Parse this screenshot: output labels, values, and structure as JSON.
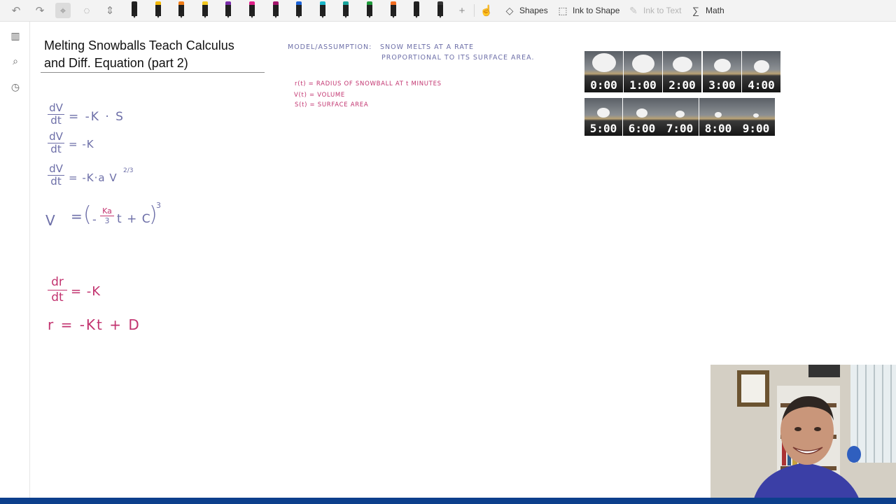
{
  "toolbar": {
    "shapes_label": "Shapes",
    "ink_to_shape_label": "Ink to Shape",
    "ink_to_text_label": "Ink to Text",
    "math_label": "Math",
    "pen_colors": [
      "#222222",
      "#f2b705",
      "#f07d18",
      "#f2c81f",
      "#7a2ca8",
      "#e0218a",
      "#a3146b",
      "#1b62d6",
      "#1ab6c9",
      "#17a39a",
      "#1e9a3a",
      "#f26d21",
      "#222222",
      "#333333"
    ]
  },
  "page": {
    "title_line1": "Melting Snowballs Teach Calculus",
    "title_line2": "and Diff. Equation (part 2)"
  },
  "notes": {
    "model_label": "MODEL/ASSUMPTION:",
    "model_line1": "SNOW MELTS AT A RATE",
    "model_line2": "PROPORTIONAL TO ITS SURFACE AREA.",
    "def_r": "r(t) = RADIUS OF SNOWBALL AT t MINUTES",
    "def_v": "V(t) = VOLUME",
    "def_s": "S(t) = SURFACE AREA"
  },
  "equations": {
    "eq1_lhs_num": "dV",
    "eq1_lhs_den": "dt",
    "eq1_rhs": "= -K · S",
    "eq2_lhs_num": "dV",
    "eq2_lhs_den": "dt",
    "eq2_rhs": "= -K",
    "eq3_lhs_num": "dV",
    "eq3_lhs_den": "dt",
    "eq3_rhs": "= -K·a V",
    "eq3_exp": "2/3",
    "eq4_lhs": "V",
    "eq4_eq": "=",
    "eq4_open": "(",
    "eq4_minus": "-",
    "eq4_frac_num": "Ka",
    "eq4_frac_den": "3",
    "eq4_tail": "t + C",
    "eq4_close": ")",
    "eq4_exp": "3",
    "eq5_lhs_num": "dr",
    "eq5_lhs_den": "dt",
    "eq5_rhs": "= -K",
    "eq6": "r = -Kt + D"
  },
  "snowball_frames": [
    "0:00",
    "1:00",
    "2:00",
    "3:00",
    "4:00",
    "5:00",
    "6:00",
    "7:00",
    "8:00",
    "9:00"
  ],
  "colors": {
    "ink_blue": "#6d6fa8",
    "ink_pink": "#c2336f",
    "taskbar": "#0d3f8c"
  }
}
